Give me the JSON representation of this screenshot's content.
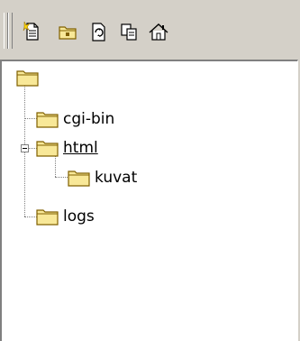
{
  "toolbar": {
    "buttons": [
      {
        "name": "new-file-button",
        "icon": "new-file-icon"
      },
      {
        "name": "new-folder-button",
        "icon": "folder-icon"
      },
      {
        "name": "refresh-button",
        "icon": "refresh-icon"
      },
      {
        "name": "copy-button",
        "icon": "copy-icon"
      },
      {
        "name": "home-button",
        "icon": "home-icon"
      }
    ]
  },
  "tree": {
    "root": "",
    "items": [
      {
        "label": "cgi-bin",
        "level": 1,
        "expanded": false
      },
      {
        "label": "html",
        "level": 1,
        "expanded": true,
        "underlined": true
      },
      {
        "label": "kuvat",
        "level": 2,
        "expanded": false
      },
      {
        "label": "logs",
        "level": 1,
        "expanded": false
      }
    ]
  },
  "colors": {
    "folder_fill": "#f8e898",
    "folder_stroke": "#806000",
    "background": "#d4d0c8"
  }
}
